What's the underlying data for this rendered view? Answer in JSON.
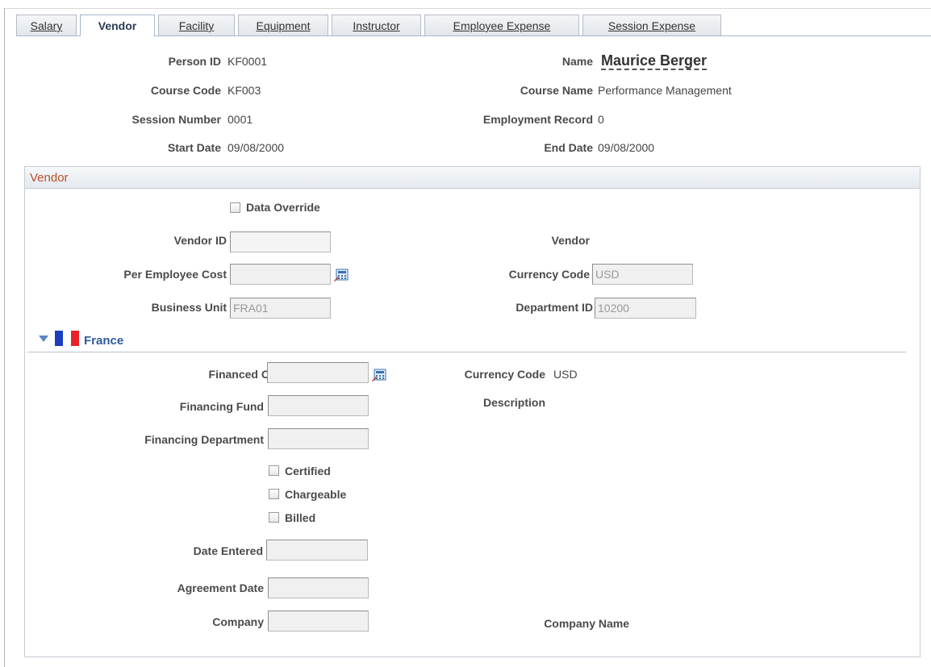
{
  "tabs": [
    {
      "label": "Salary",
      "active": false
    },
    {
      "label": "Vendor",
      "active": true
    },
    {
      "label": "Facility",
      "active": false
    },
    {
      "label": "Equipment",
      "active": false
    },
    {
      "label": "Instructor",
      "active": false
    },
    {
      "label": "Employee Expense",
      "active": false
    },
    {
      "label": "Session Expense",
      "active": false
    }
  ],
  "header": {
    "person_id_label": "Person ID",
    "person_id": "KF0001",
    "name_label": "Name",
    "name": "Maurice Berger",
    "course_code_label": "Course Code",
    "course_code": "KF003",
    "course_name_label": "Course Name",
    "course_name": "Performance Management",
    "session_number_label": "Session Number",
    "session_number": "0001",
    "employment_record_label": "Employment Record",
    "employment_record": "0",
    "start_date_label": "Start Date",
    "start_date": "09/08/2000",
    "end_date_label": "End Date",
    "end_date": "09/08/2000"
  },
  "vendor": {
    "section_title": "Vendor",
    "data_override_label": "Data Override",
    "data_override_checked": false,
    "vendor_id_label": "Vendor ID",
    "vendor_id": "",
    "vendor_label": "Vendor",
    "per_employee_cost_label": "Per Employee Cost",
    "per_employee_cost": "",
    "currency_code_label": "Currency Code",
    "currency_code": "USD",
    "business_unit_label": "Business Unit",
    "business_unit": "FRA01",
    "department_id_label": "Department ID",
    "department_id": "10200"
  },
  "france": {
    "title": "France",
    "financed_cost_label": "Financed Cost",
    "financed_cost": "",
    "currency_code_label": "Currency Code",
    "currency_code": "USD",
    "description_label": "Description",
    "financing_fund_label": "Financing Fund",
    "financing_fund": "",
    "financing_department_label": "Financing Department",
    "financing_department": "",
    "certified_label": "Certified",
    "chargeable_label": "Chargeable",
    "billed_label": "Billed",
    "date_entered_label": "Date Entered",
    "date_entered": "",
    "agreement_date_label": "Agreement Date",
    "agreement_date": "",
    "company_label": "Company",
    "company": "",
    "company_name_label": "Company Name",
    "flag_colors": [
      "#1b3fbf",
      "#ffffff",
      "#e8222a"
    ]
  },
  "colors": {
    "section_title": "#b8502a",
    "france_title": "#2f5a9e"
  },
  "icons": {
    "calculator": "calculator-icon",
    "expand": "triangle-down-icon",
    "flag": "france-flag-icon"
  }
}
